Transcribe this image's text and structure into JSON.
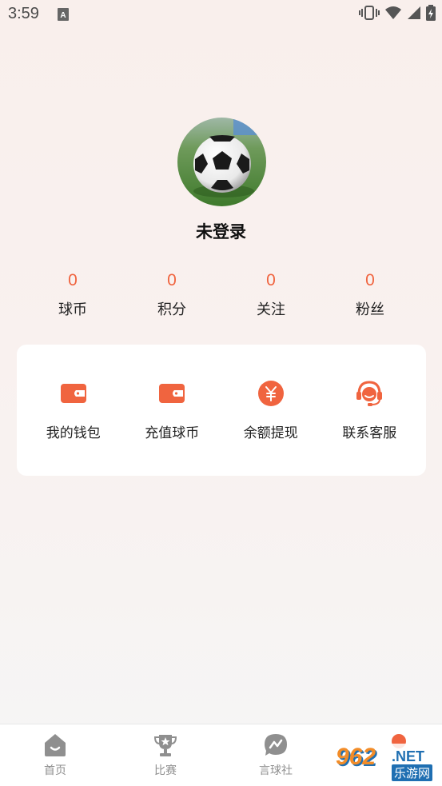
{
  "status_bar": {
    "time": "3:59"
  },
  "profile": {
    "username": "未登录"
  },
  "stats": [
    {
      "value": "0",
      "label": "球币"
    },
    {
      "value": "0",
      "label": "积分"
    },
    {
      "value": "0",
      "label": "关注"
    },
    {
      "value": "0",
      "label": "粉丝"
    }
  ],
  "actions": [
    {
      "label": "我的钱包",
      "icon": "wallet-icon"
    },
    {
      "label": "充值球币",
      "icon": "recharge-wallet-icon"
    },
    {
      "label": "余额提现",
      "icon": "yuan-coin-icon"
    },
    {
      "label": "联系客服",
      "icon": "headset-support-icon"
    }
  ],
  "tabbar": [
    {
      "label": "首页",
      "icon": "home-icon"
    },
    {
      "label": "比赛",
      "icon": "trophy-icon"
    },
    {
      "label": "言球社",
      "icon": "chat-bubble-icon"
    },
    {
      "label": "",
      "icon": "profile-icon"
    }
  ],
  "watermark": {
    "number": "962",
    "net": ".NET",
    "cn": "乐游网"
  },
  "colors": {
    "accent": "#f0643f",
    "text": "#222222",
    "tab_inactive": "#8f8f8f"
  }
}
